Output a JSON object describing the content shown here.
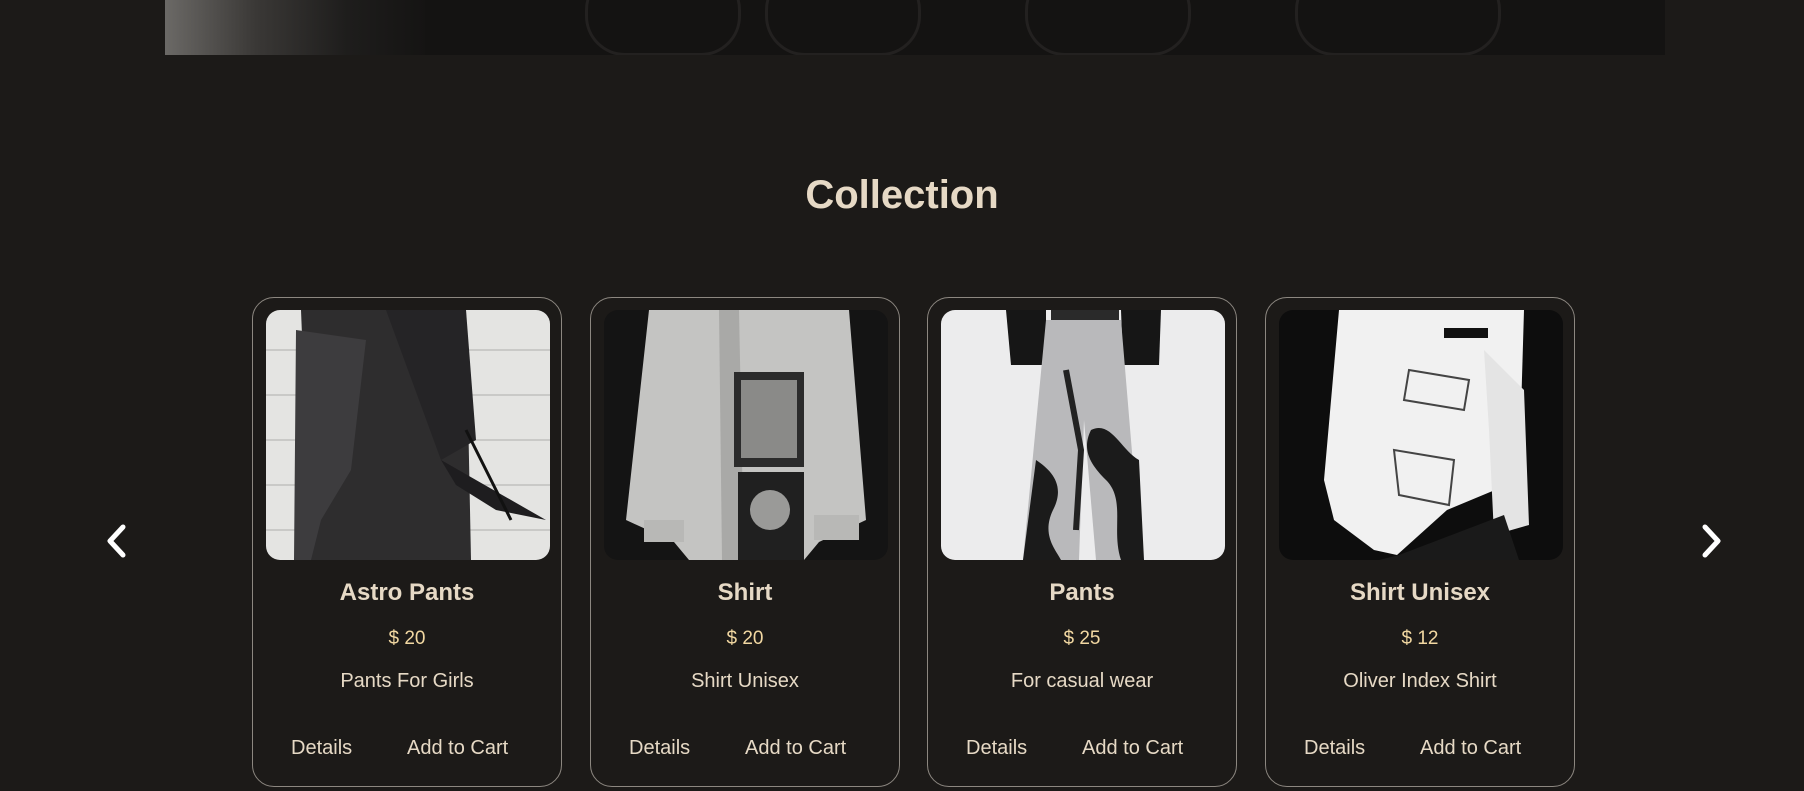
{
  "collection": {
    "title": "Collection"
  },
  "carousel": {
    "prev_icon": "chevron-left-icon",
    "next_icon": "chevron-right-icon"
  },
  "products": [
    {
      "name": "Astro Pants",
      "price": "$ 20",
      "description": "Pants For Girls",
      "details_label": "Details",
      "cart_label": "Add to Cart",
      "image": "black-wide-pants-photo"
    },
    {
      "name": "Shirt",
      "price": "$ 20",
      "description": "Shirt Unisex",
      "details_label": "Details",
      "cart_label": "Add to Cart",
      "image": "grey-print-shirt-photo"
    },
    {
      "name": "Pants",
      "price": "$ 25",
      "description": "For casual wear",
      "details_label": "Details",
      "cart_label": "Add to Cart",
      "image": "silver-black-pants-photo"
    },
    {
      "name": "Shirt Unisex",
      "price": "$ 12",
      "description": "Oliver Index Shirt",
      "details_label": "Details",
      "cart_label": "Add to Cart",
      "image": "white-helmut-shirt-photo"
    }
  ],
  "colors": {
    "background": "#1c1a18",
    "text": "#e6d9c5",
    "price": "#f2d8a2",
    "border": "#8c8780"
  }
}
